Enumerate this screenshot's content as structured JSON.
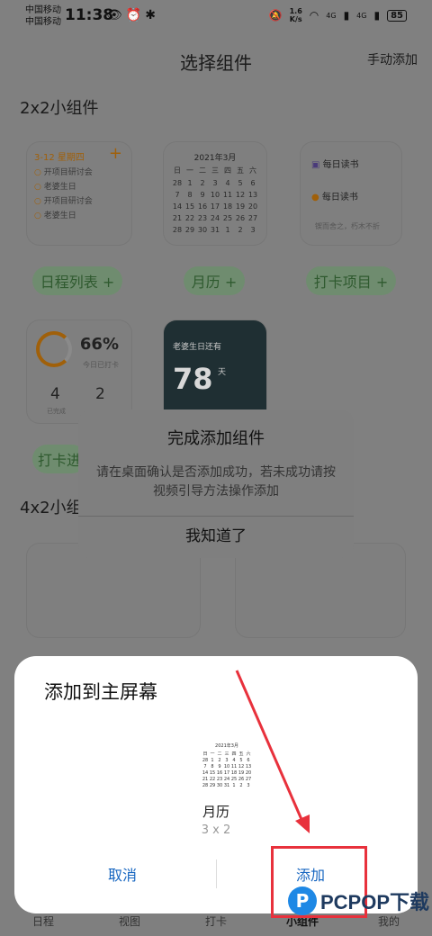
{
  "status_bar": {
    "carrier_1": "中国移动",
    "carrier_2": "中国移动",
    "time": "11:38",
    "net_speed_value": "1.6",
    "net_speed_unit": "K/s",
    "signal_1": "4G",
    "signal_2": "4G",
    "battery": "85"
  },
  "header": {
    "title": "选择组件",
    "manual_add": "手动添加"
  },
  "sections": {
    "small": "2x2小组件",
    "large": "4x2小组件"
  },
  "widgets": {
    "schedule": {
      "date": "3-12",
      "weekday": "星期四",
      "plus": "+",
      "items": [
        "开项目研讨会",
        "老婆生日",
        "开项目研讨会",
        "老婆生日"
      ]
    },
    "calendar": {
      "month": "2021年3月",
      "weekdays": [
        "日",
        "一",
        "二",
        "三",
        "四",
        "五",
        "六"
      ],
      "rows": [
        [
          "28",
          "1",
          "2",
          "3",
          "4",
          "5",
          "6"
        ],
        [
          "7",
          "8",
          "9",
          "10",
          "11",
          "12",
          "13"
        ],
        [
          "14",
          "15",
          "16",
          "17",
          "18",
          "19",
          "20"
        ],
        [
          "21",
          "22",
          "23",
          "24",
          "25",
          "26",
          "27"
        ],
        [
          "28",
          "29",
          "30",
          "31",
          "1",
          "2",
          "3"
        ]
      ]
    },
    "checkin": {
      "item_1": "每日读书",
      "item_2": "每日读书",
      "quote": "锲而舍之，朽木不折"
    },
    "pills": [
      "日程列表 +",
      "月历 +",
      "打卡项目 +",
      "打卡进"
    ],
    "progress": {
      "percent": "66%",
      "label": "今日已打卡",
      "done": "4",
      "done_label": "已完成",
      "todo": "2"
    },
    "countdown": {
      "title": "老婆生日还有",
      "days": "78",
      "unit": "天"
    }
  },
  "dialog": {
    "title": "完成添加组件",
    "message": "请在桌面确认是否添加成功，若未成功请按视频引导方法操作添加",
    "confirm": "我知道了"
  },
  "sheet": {
    "title": "添加到主屏幕",
    "preview_month": "2021年3月",
    "widget_name": "月历",
    "widget_size": "3 x 2",
    "cancel": "取消",
    "add": "添加"
  },
  "bottom_nav": [
    "日程",
    "视图",
    "打卡",
    "小组件",
    "我的"
  ],
  "watermark": "PCPOP下载",
  "colors": {
    "accent": "#1565c0",
    "highlight": "#e8313c",
    "overlay": "#808080"
  }
}
